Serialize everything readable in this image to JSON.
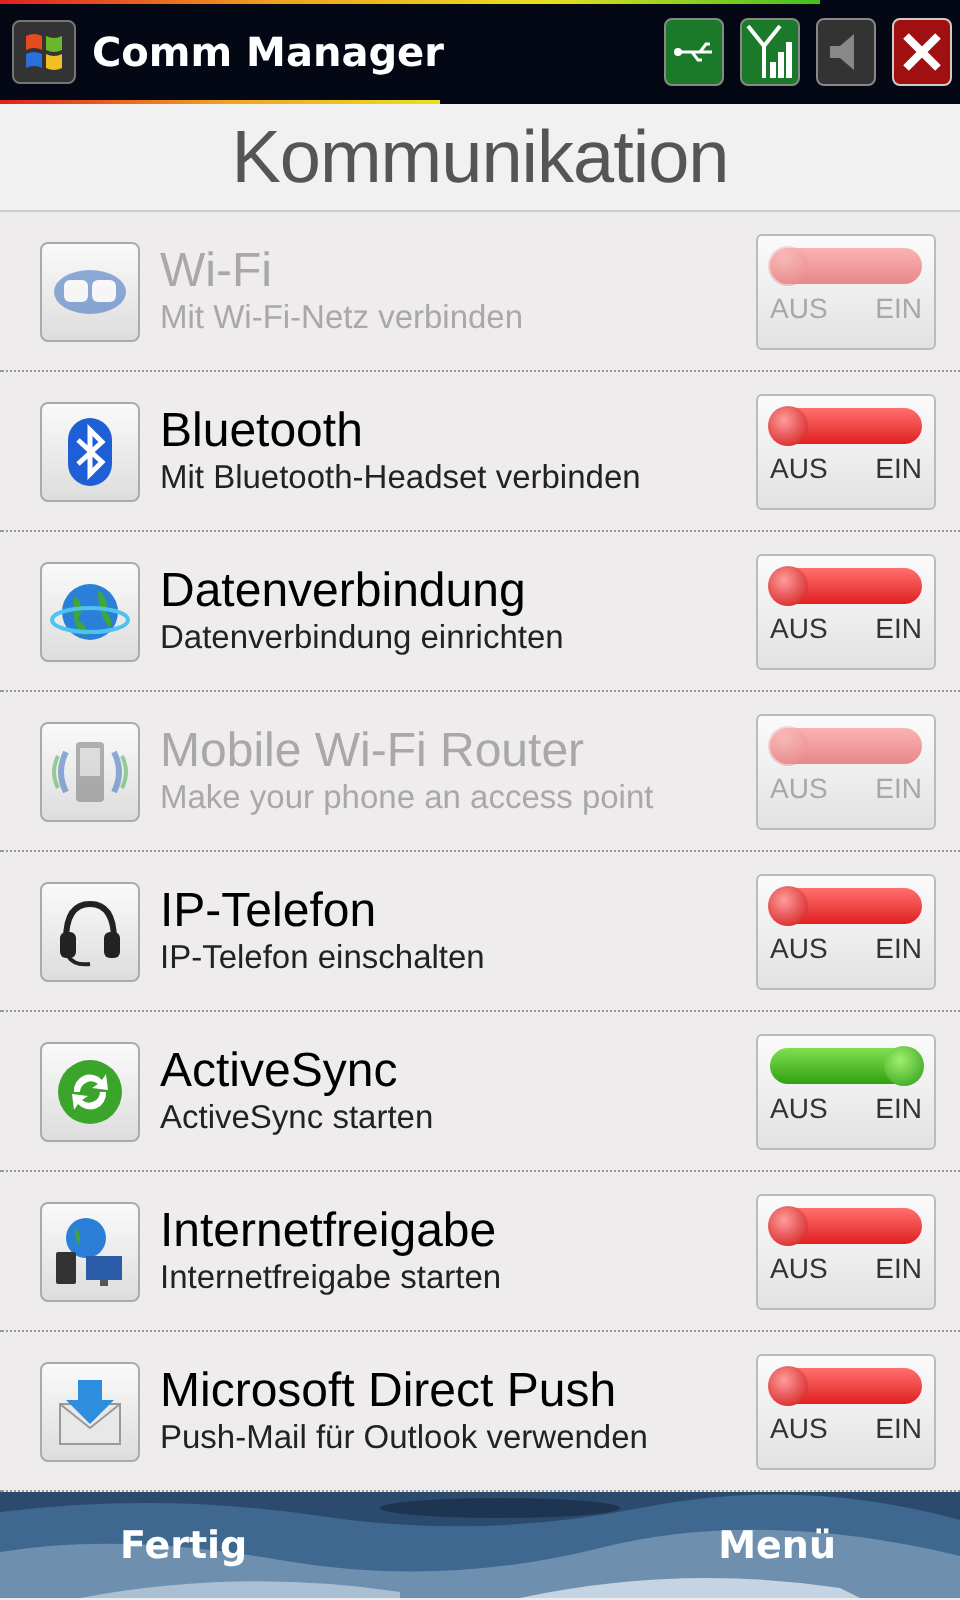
{
  "window": {
    "title": "Comm Manager"
  },
  "heading": "Kommunikation",
  "items": [
    {
      "title": "Wi-Fi",
      "subtitle": "Mit Wi-Fi-Netz verbinden",
      "on": false,
      "disabled": true,
      "off_label": "AUS",
      "on_label": "EIN"
    },
    {
      "title": "Bluetooth",
      "subtitle": "Mit Bluetooth-Headset verbinden",
      "on": false,
      "disabled": false,
      "off_label": "AUS",
      "on_label": "EIN"
    },
    {
      "title": "Datenverbindung",
      "subtitle": "Datenverbindung einrichten",
      "on": false,
      "disabled": false,
      "off_label": "AUS",
      "on_label": "EIN"
    },
    {
      "title": "Mobile Wi-Fi Router",
      "subtitle": "Make your phone an access point",
      "on": false,
      "disabled": true,
      "off_label": "AUS",
      "on_label": "EIN"
    },
    {
      "title": "IP-Telefon",
      "subtitle": "IP-Telefon einschalten",
      "on": false,
      "disabled": false,
      "off_label": "AUS",
      "on_label": "EIN"
    },
    {
      "title": "ActiveSync",
      "subtitle": "ActiveSync starten",
      "on": true,
      "disabled": false,
      "off_label": "AUS",
      "on_label": "EIN"
    },
    {
      "title": "Internetfreigabe",
      "subtitle": "Internetfreigabe starten",
      "on": false,
      "disabled": false,
      "off_label": "AUS",
      "on_label": "EIN"
    },
    {
      "title": "Microsoft Direct Push",
      "subtitle": "Push-Mail für Outlook verwenden",
      "on": false,
      "disabled": false,
      "off_label": "AUS",
      "on_label": "EIN"
    }
  ],
  "softkeys": {
    "left": "Fertig",
    "right": "Menü"
  }
}
